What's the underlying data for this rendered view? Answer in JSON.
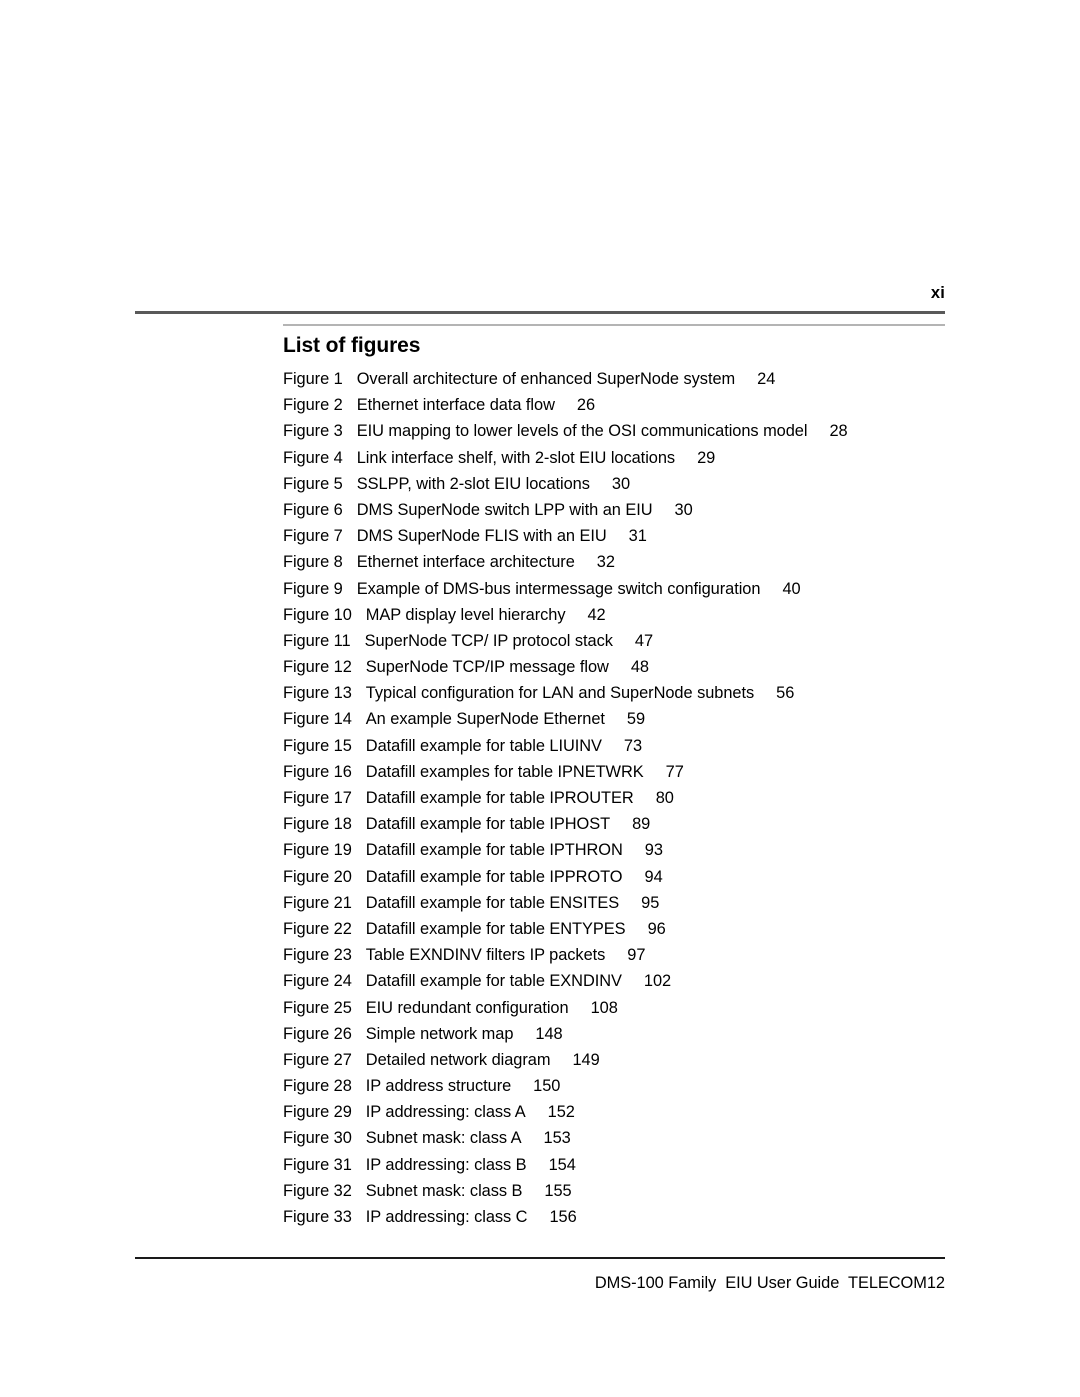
{
  "header": {
    "page_number": "xi"
  },
  "main": {
    "section_title": "List of figures",
    "figures": [
      {
        "label": "Figure 1",
        "title": "Overall architecture of enhanced SuperNode system",
        "page": "24"
      },
      {
        "label": "Figure 2",
        "title": "Ethernet interface data flow",
        "page": "26"
      },
      {
        "label": "Figure 3",
        "title": "EIU mapping to lower levels of the OSI communications model",
        "page": "28"
      },
      {
        "label": "Figure 4",
        "title": "Link interface shelf, with 2-slot EIU locations",
        "page": "29"
      },
      {
        "label": "Figure 5",
        "title": "SSLPP, with 2-slot EIU locations",
        "page": "30"
      },
      {
        "label": "Figure 6",
        "title": "DMS SuperNode switch LPP with an EIU",
        "page": "30"
      },
      {
        "label": "Figure 7",
        "title": "DMS SuperNode FLIS with an EIU",
        "page": "31"
      },
      {
        "label": "Figure 8",
        "title": "Ethernet interface architecture",
        "page": "32"
      },
      {
        "label": "Figure 9",
        "title": "Example of DMS-bus intermessage switch configuration",
        "page": "40"
      },
      {
        "label": "Figure 10",
        "title": "MAP display level hierarchy",
        "page": "42"
      },
      {
        "label": "Figure 11",
        "title": "SuperNode TCP/ IP protocol stack",
        "page": "47"
      },
      {
        "label": "Figure 12",
        "title": "SuperNode TCP/IP message flow",
        "page": "48"
      },
      {
        "label": "Figure 13",
        "title": "Typical configuration for LAN and SuperNode subnets",
        "page": "56"
      },
      {
        "label": "Figure 14",
        "title": "An example SuperNode Ethernet",
        "page": "59"
      },
      {
        "label": "Figure 15",
        "title": "Datafill example for table LIUINV",
        "page": "73"
      },
      {
        "label": "Figure 16",
        "title": "Datafill examples for table IPNETWRK",
        "page": "77"
      },
      {
        "label": "Figure 17",
        "title": "Datafill example for table IPROUTER",
        "page": "80"
      },
      {
        "label": "Figure 18",
        "title": "Datafill example for table IPHOST",
        "page": "89"
      },
      {
        "label": "Figure 19",
        "title": "Datafill example for table IPTHRON",
        "page": "93"
      },
      {
        "label": "Figure 20",
        "title": "Datafill example for table IPPROTO",
        "page": "94"
      },
      {
        "label": "Figure 21",
        "title": "Datafill example for table ENSITES",
        "page": "95"
      },
      {
        "label": "Figure 22",
        "title": "Datafill example for table ENTYPES",
        "page": "96"
      },
      {
        "label": "Figure 23",
        "title": "Table EXNDINV filters IP packets",
        "page": "97"
      },
      {
        "label": "Figure 24",
        "title": "Datafill example for table EXNDINV",
        "page": "102"
      },
      {
        "label": "Figure 25",
        "title": "EIU redundant configuration",
        "page": "108"
      },
      {
        "label": "Figure 26",
        "title": "Simple network map",
        "page": "148"
      },
      {
        "label": "Figure 27",
        "title": "Detailed network diagram",
        "page": "149"
      },
      {
        "label": "Figure 28",
        "title": "IP address structure",
        "page": "150"
      },
      {
        "label": "Figure 29",
        "title": "IP addressing: class A",
        "page": "152"
      },
      {
        "label": "Figure 30",
        "title": "Subnet mask: class A",
        "page": "153"
      },
      {
        "label": "Figure 31",
        "title": "IP addressing: class B",
        "page": "154"
      },
      {
        "label": "Figure 32",
        "title": "Subnet mask: class B",
        "page": "155"
      },
      {
        "label": "Figure 33",
        "title": "IP addressing: class C",
        "page": "156"
      }
    ]
  },
  "footer": {
    "text": "DMS-100 Family  EIU User Guide  TELECOM12"
  }
}
